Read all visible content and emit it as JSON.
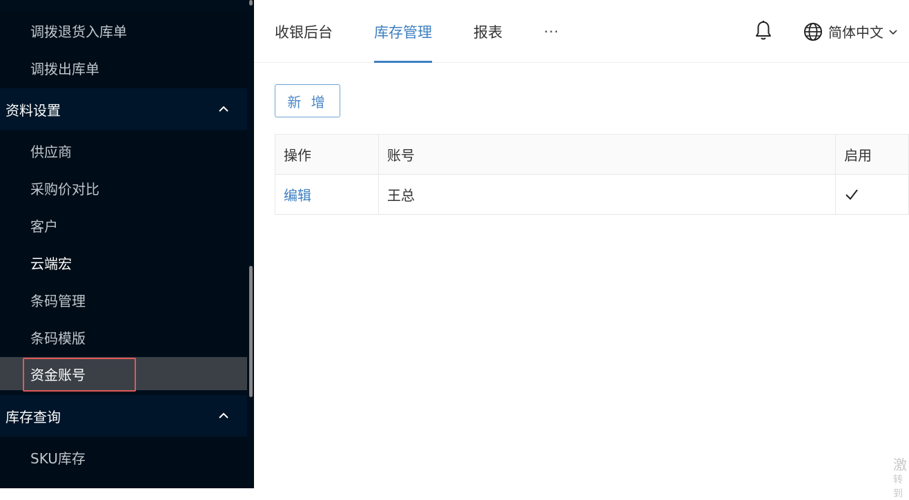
{
  "sidebar": {
    "items": [
      {
        "label": "调拨退货入库单"
      },
      {
        "label": "调拨出库单"
      },
      {
        "label": "供应商"
      },
      {
        "label": "采购价对比"
      },
      {
        "label": "客户"
      },
      {
        "label": "云端宏"
      },
      {
        "label": "条码管理"
      },
      {
        "label": "条码模版"
      },
      {
        "label": "资金账号"
      },
      {
        "label": "SKU库存"
      }
    ],
    "groups": [
      {
        "label": "资料设置"
      },
      {
        "label": "库存查询"
      }
    ],
    "active_item": "资金账号"
  },
  "header": {
    "tabs": [
      {
        "label": "收银后台"
      },
      {
        "label": "库存管理"
      },
      {
        "label": "报表"
      }
    ],
    "active_tab": "库存管理",
    "more_label": "···",
    "language": "简体中文"
  },
  "main": {
    "add_button": "新 增",
    "table": {
      "columns": [
        "操作",
        "账号",
        "启用"
      ],
      "rows": [
        {
          "action": "编辑",
          "account": "王总",
          "enabled": true
        }
      ]
    }
  },
  "watermark": {
    "line1": "激",
    "line2": "转到"
  },
  "colors": {
    "accent": "#3d7fc1",
    "sidebar_bg": "#000c17",
    "sidebar_group_bg": "#001529",
    "active_item_bg": "#3a4046",
    "highlight_border": "#e05a5a"
  }
}
